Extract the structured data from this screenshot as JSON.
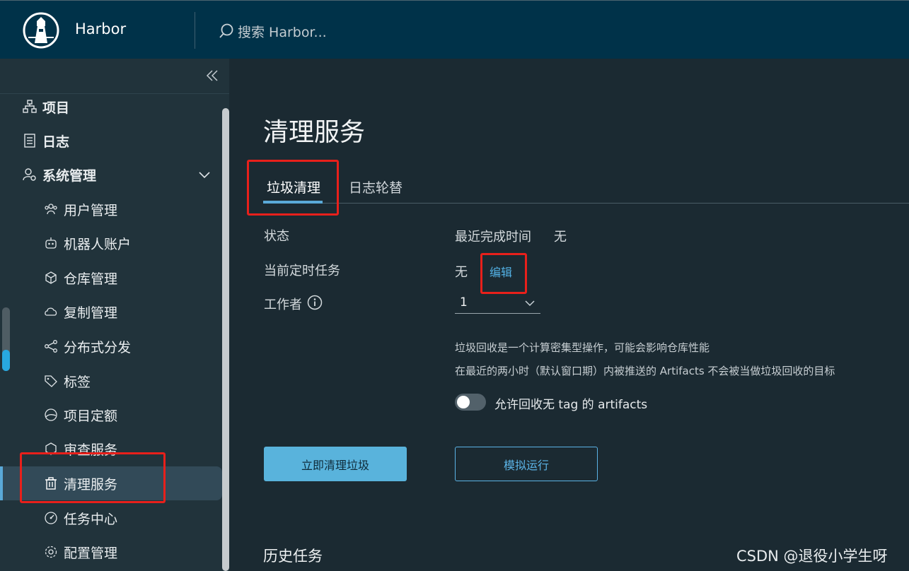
{
  "header": {
    "app_title": "Harbor",
    "search_placeholder": "搜索 Harbor..."
  },
  "sidebar": {
    "top_items": [
      {
        "label": "项目",
        "icon": "project-icon"
      },
      {
        "label": "日志",
        "icon": "log-icon"
      },
      {
        "label": "系统管理",
        "icon": "system-admin-icon",
        "expanded": true
      }
    ],
    "sub_items": [
      {
        "label": "用户管理",
        "icon": "users-icon"
      },
      {
        "label": "机器人账户",
        "icon": "robot-icon"
      },
      {
        "label": "仓库管理",
        "icon": "registry-icon"
      },
      {
        "label": "复制管理",
        "icon": "replication-icon"
      },
      {
        "label": "分布式分发",
        "icon": "distribution-icon"
      },
      {
        "label": "标签",
        "icon": "tag-icon"
      },
      {
        "label": "项目定额",
        "icon": "quota-icon"
      },
      {
        "label": "审查服务",
        "icon": "interrogation-icon"
      },
      {
        "label": "清理服务",
        "icon": "trash-icon",
        "active": true
      },
      {
        "label": "任务中心",
        "icon": "job-center-icon"
      },
      {
        "label": "配置管理",
        "icon": "config-icon"
      }
    ]
  },
  "main": {
    "page_title": "清理服务",
    "tabs": [
      {
        "label": "垃圾清理",
        "active": true
      },
      {
        "label": "日志轮替",
        "active": false
      }
    ],
    "status_label": "状态",
    "last_completed_label": "最近完成时间",
    "last_completed_value": "无",
    "schedule_label": "当前定时任务",
    "schedule_value": "无",
    "edit_label": "编辑",
    "workers_label": "工作者",
    "workers_value": "1",
    "note_line1": "垃圾回收是一个计算密集型操作，可能会影响仓库性能",
    "note_line2": "在最近的两小时（默认窗口期）内被推送的 Artifacts 不会被当做垃圾回收的目标",
    "toggle_label": "允许回收无 tag 的 artifacts",
    "toggle_on": false,
    "gc_now_button": "立即清理垃圾",
    "dry_run_button": "模拟运行",
    "history_title": "历史任务"
  },
  "watermark": "CSDN @退役小学生呀",
  "colors": {
    "header_bg": "#003249",
    "sidebar_bg": "#21333b",
    "main_bg": "#1b2a32",
    "accent": "#5aa9d8",
    "highlight_box": "#e8201b"
  }
}
